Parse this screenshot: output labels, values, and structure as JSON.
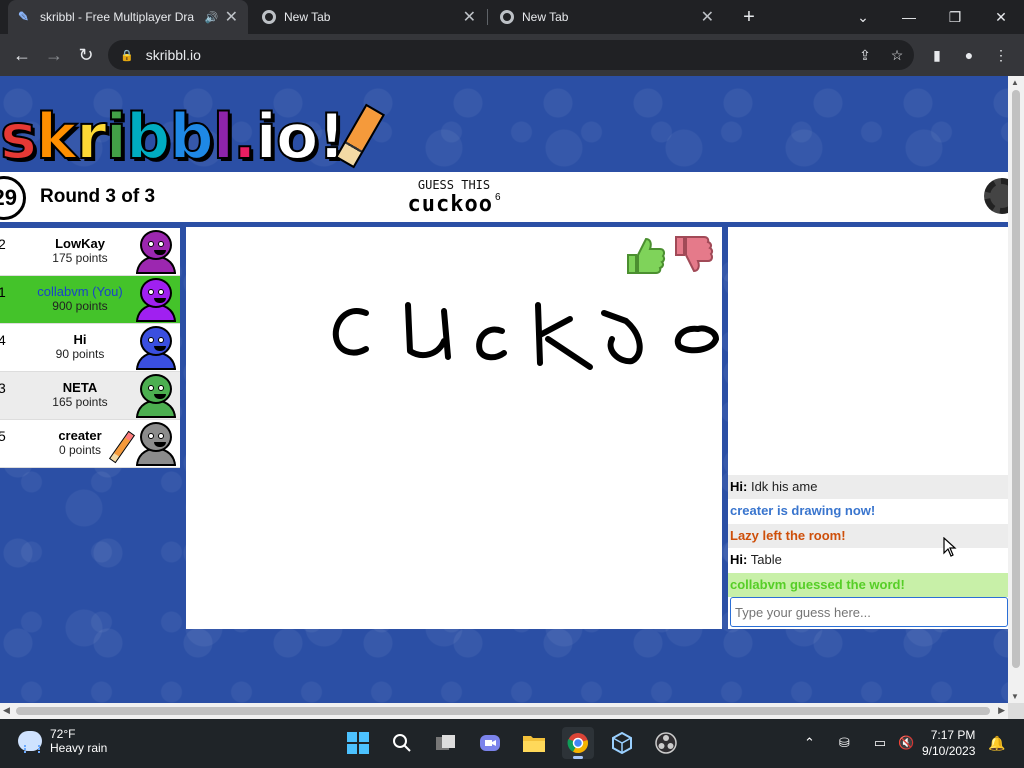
{
  "browser": {
    "tabs": [
      {
        "title": "skribbl - Free Multiplayer Dra",
        "active": true,
        "favicon": "skribbl-pencil-icon"
      },
      {
        "title": "New Tab",
        "active": false,
        "favicon": "chrome-icon"
      },
      {
        "title": "New Tab",
        "active": false,
        "favicon": "chrome-icon"
      }
    ],
    "new_tab": "+",
    "url": "skribbl.io"
  },
  "game": {
    "logo": [
      "s",
      "k",
      "r",
      "i",
      "b",
      "b",
      "l",
      ".",
      "i",
      "o",
      "!"
    ],
    "logo_colors": [
      "#e53935",
      "#ff8f00",
      "#fdd835",
      "#43a047",
      "#00acc1",
      "#1e88e5",
      "#8e24aa",
      "#e91e63",
      "#ffffff",
      "#ffffff",
      "#ffffff"
    ],
    "timer": "29",
    "round": "Round 3 of 3",
    "guess_label": "GUESS THIS",
    "word": "cuckoo",
    "word_length": "6"
  },
  "players": [
    {
      "rank": "2",
      "name": "LowKay",
      "points": "175 points",
      "color": "#9c27b0",
      "me": false,
      "drawing": false
    },
    {
      "rank": "1",
      "name": "collabvm (You)",
      "points": "900 points",
      "color": "#a020f0",
      "me": true,
      "drawing": false
    },
    {
      "rank": "4",
      "name": "Hi",
      "points": "90 points",
      "color": "#3a4fe0",
      "me": false,
      "drawing": false
    },
    {
      "rank": "3",
      "name": "NETA",
      "points": "165 points",
      "color": "#4caf50",
      "me": false,
      "drawing": false
    },
    {
      "rank": "5",
      "name": "creater",
      "points": "0 points",
      "color": "#8c8c8c",
      "me": false,
      "drawing": true
    }
  ],
  "chat": {
    "messages": [
      {
        "author": "Hi:",
        "text": "Idk his ame",
        "kind": "normal"
      },
      {
        "author": "",
        "text": "creater is drawing now!",
        "kind": "blue"
      },
      {
        "author": "",
        "text": "Lazy left the room!",
        "kind": "red"
      },
      {
        "author": "Hi:",
        "text": "Table",
        "kind": "normal"
      },
      {
        "author": "",
        "text": "collabvm guessed the word!",
        "kind": "green"
      }
    ],
    "input_placeholder": "Type your guess here..."
  },
  "taskbar": {
    "weather_temp": "72°F",
    "weather_desc": "Heavy rain",
    "time": "7:17 PM",
    "date": "9/10/2023"
  }
}
